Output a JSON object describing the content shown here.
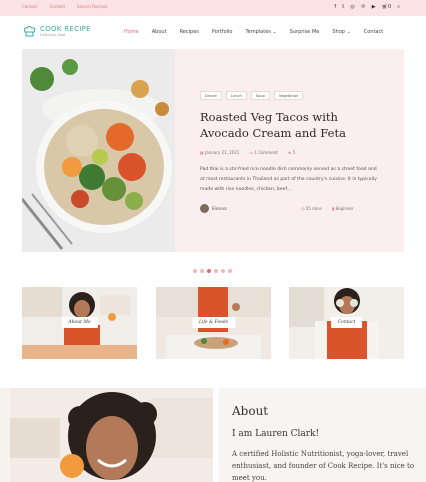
{
  "topbar": {
    "links": [
      "Contact",
      "Contact",
      "Search Recipes"
    ],
    "social_icons": [
      "facebook-icon",
      "twitter-icon",
      "instagram-icon",
      "pinterest-icon",
      "youtube-icon",
      "cart-icon",
      "search-icon"
    ],
    "cart_count": "0"
  },
  "header": {
    "logo_title": "COOK RECIPE",
    "logo_subtitle": "Delicious food",
    "nav": [
      {
        "label": "Home",
        "active": true
      },
      {
        "label": "About"
      },
      {
        "label": "Recipes"
      },
      {
        "label": "Portfolio"
      },
      {
        "label": "Templates"
      },
      {
        "label": "Surprise Me"
      },
      {
        "label": "Shop"
      },
      {
        "label": "Contact"
      }
    ]
  },
  "hero": {
    "tags": [
      "Dinner",
      "Lunch",
      "Soup",
      "Vegetarian"
    ],
    "title": "Roasted Veg Tacos with Avocado Cream and Feta",
    "date": "January 21, 2021",
    "comments": "1 Comment",
    "likes": "5",
    "excerpt": "Pad thai is a stir-fried rice noodle dish commonly served as a street food and at most restaurants in Thailand as part of the country's cuisine. It is typically made with rice noodles, chicken, beef...",
    "author": "Eleanor",
    "time": "55 mins",
    "level": "Beginner"
  },
  "slider": {
    "count": 6,
    "active": 2
  },
  "cards": [
    {
      "label": "About Me"
    },
    {
      "label": "Life & Foods"
    },
    {
      "label": "Contact"
    }
  ],
  "about": {
    "heading": "About",
    "name": "I am Lauren Clark!",
    "text": "A certified Holistic Nutritionist, yoga-lover, travel enthusiast, and founder of Cook Recipe. It's nice to meet you."
  },
  "colors": {
    "accent": "#e56b6f",
    "brand": "#3aa9a8",
    "topbar_bg": "#fbe3e6",
    "hero_bg": "#fbeeee"
  }
}
